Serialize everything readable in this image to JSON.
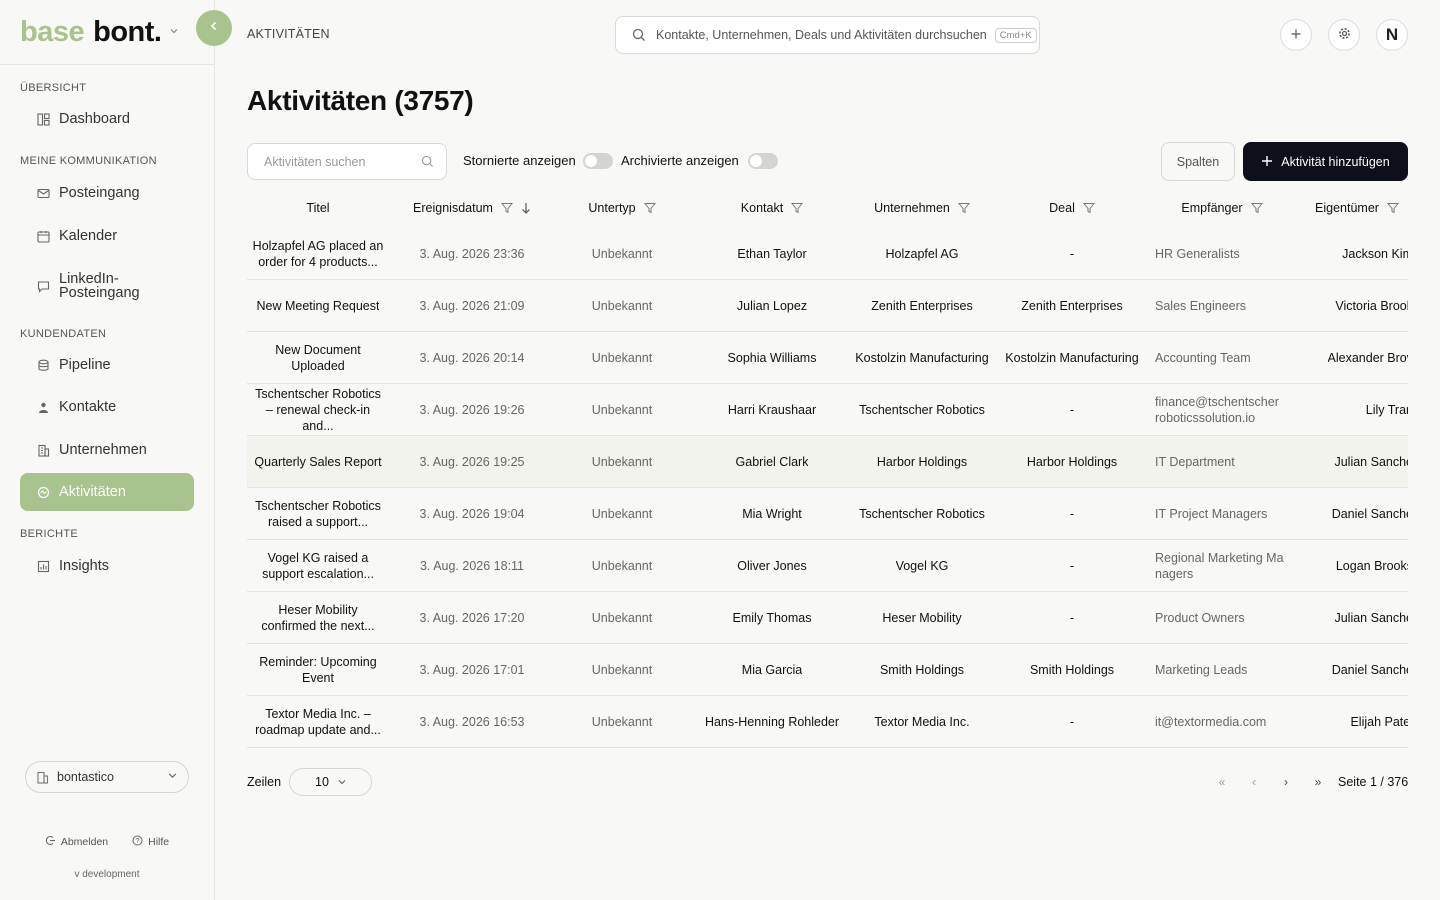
{
  "brand": {
    "part1": "base",
    "part2": "bont."
  },
  "sidebar": {
    "sections": [
      {
        "label": "ÜBERSICHT"
      },
      {
        "label": "MEINE KOMMUNIKATION"
      },
      {
        "label": "KUNDENDATEN"
      },
      {
        "label": "BERICHTE"
      }
    ],
    "items": [
      {
        "label": "Dashboard",
        "icon": "dashboard-icon"
      },
      {
        "label": "Posteingang",
        "icon": "mail-icon"
      },
      {
        "label": "Kalender",
        "icon": "calendar-icon"
      },
      {
        "label": "LinkedIn-\nPosteingang",
        "icon": "chat-icon"
      },
      {
        "label": "Pipeline",
        "icon": "database-icon"
      },
      {
        "label": "Kontakte",
        "icon": "contacts-icon"
      },
      {
        "label": "Unternehmen",
        "icon": "building-icon"
      },
      {
        "label": "Aktivitäten",
        "icon": "activity-icon",
        "active": true
      },
      {
        "label": "Insights",
        "icon": "chart-icon"
      }
    ],
    "org": "bontastico",
    "logout": "Abmelden",
    "help": "Hilfe",
    "version": "v development"
  },
  "header": {
    "breadcrumb": "AKTIVITÄTEN",
    "search_placeholder": "Kontakte, Unternehmen, Deals und Aktivitäten durchsuchen",
    "shortcut": "Cmd+K",
    "avatar": "N"
  },
  "page": {
    "title": "Aktivitäten (3757)",
    "filter_placeholder": "Aktivitäten suchen",
    "toggle_cancelled": "Stornierte anzeigen",
    "toggle_archived": "Archivierte anzeigen",
    "columns_button": "Spalten",
    "add_button": "Aktivität hinzufügen"
  },
  "table": {
    "columns": [
      "Titel",
      "Ereignisdatum",
      "Untertyp",
      "Kontakt",
      "Unternehmen",
      "Deal",
      "Empfänger",
      "Eigentümer"
    ],
    "rows": [
      [
        "Holzapfel AG placed an order for 4 products...",
        "3. Aug. 2026 23:36",
        "Unbekannt",
        "Ethan Taylor",
        "Holzapfel AG",
        "-",
        "HR Generalists",
        "Jackson Kim"
      ],
      [
        "New Meeting Request",
        "3. Aug. 2026 21:09",
        "Unbekannt",
        "Julian Lopez",
        "Zenith Enterprises",
        "Zenith Enterprises",
        "Sales Engineers",
        "Victoria Brook"
      ],
      [
        "New Document Uploaded",
        "3. Aug. 2026 20:14",
        "Unbekannt",
        "Sophia Williams",
        "Kostolzin Manufacturing",
        "Kostolzin Manufacturing",
        "Accounting Team",
        "Alexander Brov"
      ],
      [
        "Tschentscher Robotics – renewal check-in and...",
        "3. Aug. 2026 19:26",
        "Unbekannt",
        "Harri Kraushaar",
        "Tschentscher Robotics",
        "-",
        "finance@tschentscher roboticssolution.io",
        "Lily Tran"
      ],
      [
        "Quarterly Sales Report",
        "3. Aug. 2026 19:25",
        "Unbekannt",
        "Gabriel Clark",
        "Harbor Holdings",
        "Harbor Holdings",
        "IT Department",
        "Julian Sanche"
      ],
      [
        "Tschentscher Robotics raised a support...",
        "3. Aug. 2026 19:04",
        "Unbekannt",
        "Mia Wright",
        "Tschentscher Robotics",
        "-",
        "IT Project Managers",
        "Daniel Sanche"
      ],
      [
        "Vogel KG raised a support escalation...",
        "3. Aug. 2026 18:11",
        "Unbekannt",
        "Oliver Jones",
        "Vogel KG",
        "-",
        "Regional Marketing Ma nagers",
        "Logan Brooks"
      ],
      [
        "Heser Mobility confirmed the next...",
        "3. Aug. 2026 17:20",
        "Unbekannt",
        "Emily Thomas",
        "Heser Mobility",
        "-",
        "Product Owners",
        "Julian Sanche"
      ],
      [
        "Reminder: Upcoming Event",
        "3. Aug. 2026 17:01",
        "Unbekannt",
        "Mia Garcia",
        "Smith Holdings",
        "Smith Holdings",
        "Marketing Leads",
        "Daniel Sanche"
      ],
      [
        "Textor Media Inc. – roadmap update and...",
        "3. Aug. 2026 16:53",
        "Unbekannt",
        "Hans-Henning Rohleder",
        "Textor Media Inc.",
        "-",
        "it@textormedia.com",
        "Elijah Patel"
      ]
    ],
    "highlighted_row": 4
  },
  "pagination": {
    "rows_label": "Zeilen",
    "rows_value": "10",
    "page_label": "Seite 1 / 376"
  },
  "colors": {
    "accent": "#a9c38e",
    "primary": "#0d0f1a",
    "background": "#f8f8f6"
  }
}
